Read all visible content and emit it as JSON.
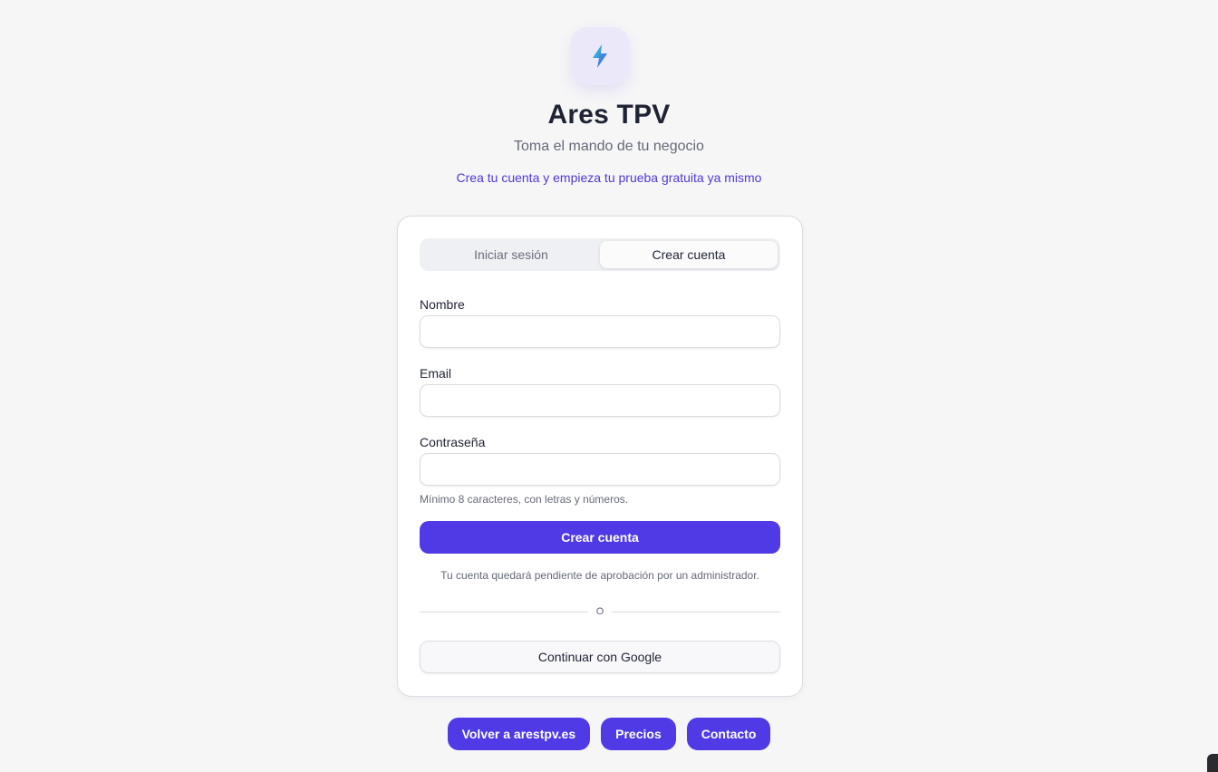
{
  "brand": {
    "logo_icon": "lightning-bolt-icon",
    "title": "Ares TPV",
    "subtitle": "Toma el mando de tu negocio",
    "tagline": "Crea tu cuenta y empieza tu prueba gratuita ya mismo"
  },
  "colors": {
    "accent": "#4f3ae6",
    "logo_bg": "#ebe8fa",
    "background": "#f6f6f7"
  },
  "tabs": [
    {
      "label": "Iniciar sesión",
      "active": false
    },
    {
      "label": "Crear cuenta",
      "active": true
    }
  ],
  "form": {
    "name_label": "Nombre",
    "name_value": "",
    "name_placeholder": "",
    "email_label": "Email",
    "email_value": "",
    "email_placeholder": "",
    "password_label": "Contraseña",
    "password_value": "",
    "password_placeholder": "",
    "password_hint": "Mínimo 8 caracteres, con letras y números.",
    "submit_label": "Crear cuenta",
    "approval_notice": "Tu cuenta quedará pendiente de aprobación por un administrador.",
    "divider_text": "O",
    "google_label": "Continuar con Google"
  },
  "footer": {
    "links": [
      {
        "label": "Volver a arestpv.es"
      },
      {
        "label": "Precios"
      },
      {
        "label": "Contacto"
      }
    ]
  }
}
